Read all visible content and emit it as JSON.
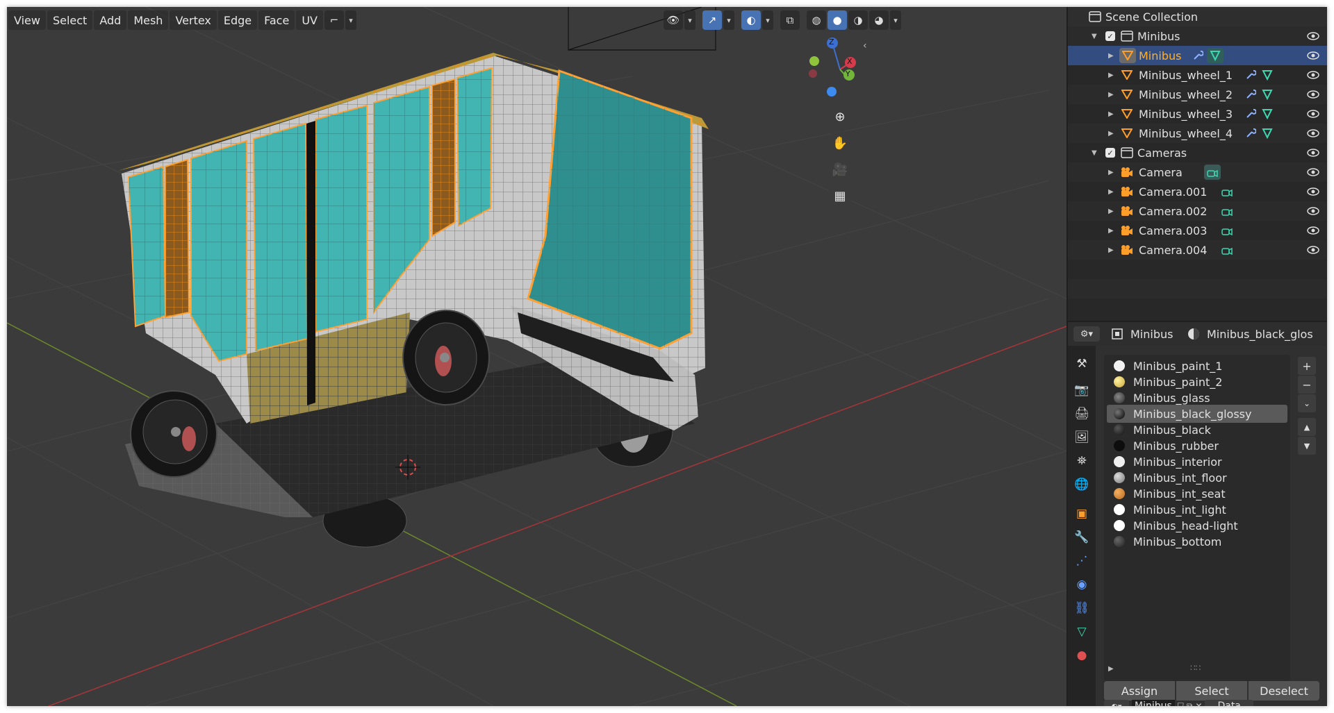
{
  "viewport": {
    "menus": [
      "View",
      "Select",
      "Add",
      "Mesh",
      "Vertex",
      "Edge",
      "Face",
      "UV"
    ],
    "gizmo": {
      "z_label": "Z",
      "x_label": "X",
      "y_label": "Y"
    }
  },
  "outliner": {
    "scene_collection_label": "Scene Collection",
    "rows": [
      {
        "name": "Minibus",
        "kind": "collection"
      },
      {
        "name": "Minibus",
        "kind": "mesh",
        "selected": true
      },
      {
        "name": "Minibus_wheel_1",
        "kind": "mesh"
      },
      {
        "name": "Minibus_wheel_2",
        "kind": "mesh"
      },
      {
        "name": "Minibus_wheel_3",
        "kind": "mesh"
      },
      {
        "name": "Minibus_wheel_4",
        "kind": "mesh"
      },
      {
        "name": "Cameras",
        "kind": "collection"
      },
      {
        "name": "Camera",
        "kind": "camera"
      },
      {
        "name": "Camera.001",
        "kind": "camera"
      },
      {
        "name": "Camera.002",
        "kind": "camera"
      },
      {
        "name": "Camera.003",
        "kind": "camera"
      },
      {
        "name": "Camera.004",
        "kind": "camera"
      }
    ]
  },
  "properties": {
    "object_name": "Minibus",
    "material_name": "Minibus_black_glos",
    "slots": [
      {
        "name": "Minibus_paint_1",
        "color": "#f2f2f2"
      },
      {
        "name": "Minibus_paint_2",
        "color": "#e3c75a"
      },
      {
        "name": "Minibus_glass",
        "color": "#3a3a3a"
      },
      {
        "name": "Minibus_black_glossy",
        "color": "#111111",
        "selected": true
      },
      {
        "name": "Minibus_black",
        "color": "#1a1a1a"
      },
      {
        "name": "Minibus_rubber",
        "color": "#0d0d0d"
      },
      {
        "name": "Minibus_interior",
        "color": "#f0f0f0"
      },
      {
        "name": "Minibus_int_floor",
        "color": "#9a9a9a"
      },
      {
        "name": "Minibus_int_seat",
        "color": "#d98a3a"
      },
      {
        "name": "Minibus_int_light",
        "color": "#ffffff"
      },
      {
        "name": "Minibus_head-light",
        "color": "#ffffff"
      },
      {
        "name": "Minibus_bottom",
        "color": "#444444"
      }
    ],
    "actions": {
      "assign": "Assign",
      "select": "Select",
      "deselect": "Deselect"
    },
    "footer": {
      "datablock": "Minibus",
      "link": "Data"
    }
  },
  "colors": {
    "selection_orange": "#ffa033",
    "glass_teal": "#3bb7b5",
    "active_blue": "#4772b3"
  }
}
